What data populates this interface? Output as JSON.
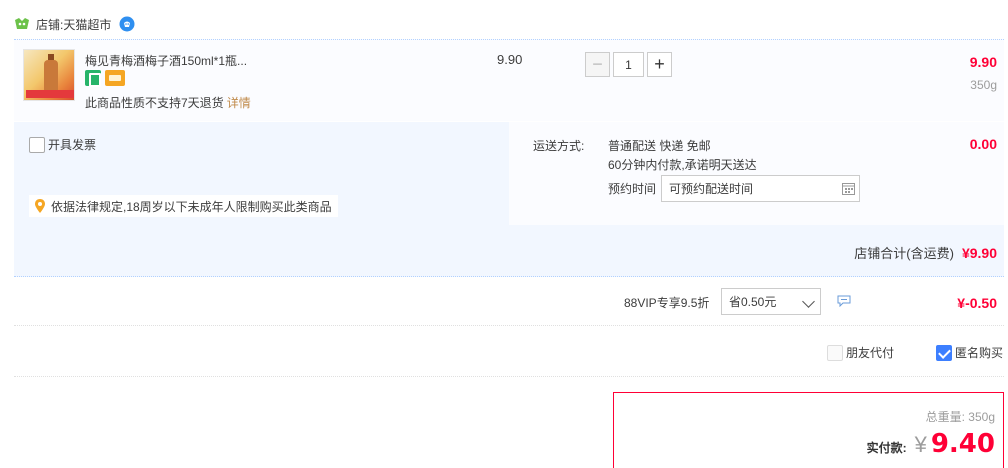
{
  "shop": {
    "label": "店铺:天猫超市",
    "icon": "tmall-shop-icon",
    "chat_icon": "wangwang-chat-icon"
  },
  "item": {
    "title": "梅见青梅酒梅子酒150ml*1瓶...",
    "badges": [
      "seven-day-return-badge-icon",
      "payment-card-badge-icon"
    ],
    "notice": "此商品性质不支持7天退货",
    "notice_link": "详情",
    "unit_price": "9.90",
    "quantity": "1",
    "minus_label": "−",
    "plus_label": "+",
    "total": "9.90",
    "weight": "350g"
  },
  "invoice": {
    "label": "开具发票",
    "checked": false
  },
  "law_tip": "依据法律规定,18周岁以下未成年人限制购买此类商品",
  "shipping": {
    "label": "运送方式:",
    "method": "普通配送 快递 免邮",
    "promise": "60分钟内付款,承诺明天送达",
    "appointment_label": "预约时间",
    "appointment_value": "可预约配送时间",
    "fee": "0.00"
  },
  "shop_total": {
    "label": "店铺合计(含运费)",
    "value": "¥9.90"
  },
  "vip": {
    "label": "88VIP专享9.5折",
    "select_value": "省0.50元",
    "discount": "¥-0.50"
  },
  "options": {
    "friend_pay_label": "朋友代付",
    "friend_pay_checked": false,
    "anonymous_label": "匿名购买",
    "anonymous_checked": true
  },
  "summary": {
    "total_weight": "总重量: 350g",
    "pay_label": "实付款:",
    "currency": "¥",
    "amount": "9.40"
  },
  "colors": {
    "price_red": "#ff0036",
    "link_gold": "#c08a4a",
    "check_blue": "#3d7fff",
    "row_tint": "#f2f7ff"
  }
}
